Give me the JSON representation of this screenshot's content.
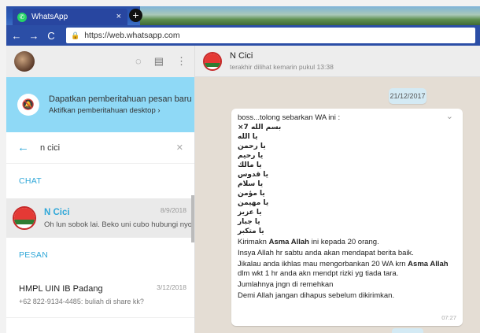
{
  "browser": {
    "tab_title": "WhatsApp",
    "tab_close": "×",
    "new_tab": "+",
    "url": "https://web.whatsapp.com"
  },
  "left": {
    "notification": {
      "title": "Dapatkan pemberitahuan pesan baru",
      "subtitle": "Aktifkan pemberitahuan desktop ›"
    },
    "search": {
      "value": "n cici"
    },
    "section_chat": "CHAT",
    "chat": {
      "name": "N Cici",
      "preview": "Oh lun sobok lai. Beko uni cubo hubungi nyo",
      "date": "8/9/2018"
    },
    "section_messages": "PESAN",
    "message": {
      "name": "HMPL UIN IB Padang",
      "preview": "+62 822-9134-4485: buliah di share kk?",
      "date": "3/12/2018"
    }
  },
  "right": {
    "contact": {
      "name": "N Cici",
      "status": "terakhir dilihat kemarin pukul 13:38"
    },
    "date_chip": "21/12/2017",
    "message": {
      "line1": "boss...tolong sebarkan WA ini :",
      "arabic": [
        "بسم الله 7×",
        "يا الله",
        "يا رحمن",
        "يا رحيم",
        "يا مالك",
        "يا قدوس",
        "يا سلام",
        "يا مؤمن",
        "يا مهيمن",
        "يا عزيز",
        "يا جبار",
        "يا متكبر"
      ],
      "send_pre": "Kirimakn ",
      "asma1": "Asma Allah",
      "send_post": " ini kepada 20 orang.",
      "line_insya": "Insya Allah hr sabtu anda akan mendapat berita baik.",
      "ikhlas_pre": "Jikalau anda ikhlas mau mengorbankan 20 WA krn ",
      "asma2": "Asma Allah",
      "ikhlas_post": " dlm wkt 1 hr anda akn mendpt rizki yg tiada tara.",
      "line_jumlah": "Jumlahnya jngn di remehkan",
      "line_demi": "Demi Allah jangan dihapus sebelum dikirimkan.",
      "time": "07:27"
    }
  }
}
